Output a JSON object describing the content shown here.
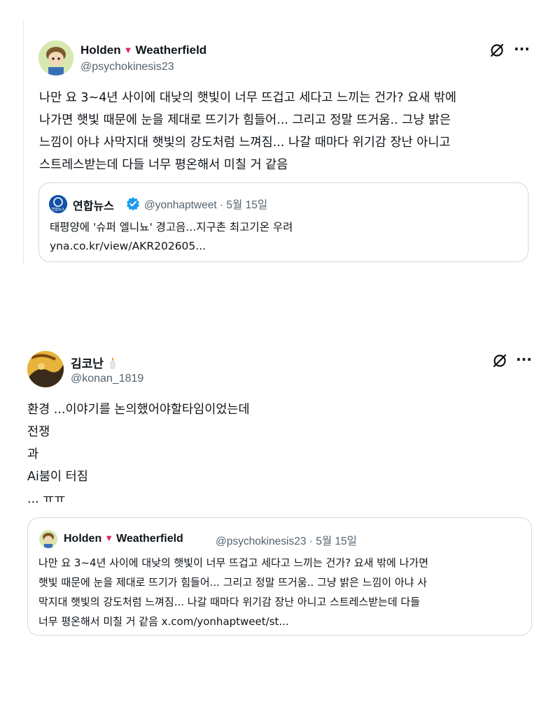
{
  "tweet1": {
    "author_name_first": "Holden",
    "author_name_last": "Weatherfield",
    "heart_glyph": "▼",
    "handle": "@psychokinesis23",
    "body_lines": [
      "나만 요 3~4년 사이에 대낮의 햇빛이 너무 뜨겁고 세다고 느끼는 건가? 요새 밖에",
      "나가면 햇빛 때문에 눈을 제대로 뜨기가 힘들어... 그리고 정말 뜨거움.. 그냥 밝은",
      "느낌이 아냐 사막지대 햇빛의 강도처럼 느껴짐... 나갈 때마다 위기감 장난 아니고",
      "스트레스받는데 다들 너무 평온해서 미칠 거 같음"
    ],
    "more_glyph": "···",
    "quote": {
      "logo_text": "연합뉴스",
      "name": "연합뉴스",
      "handle_date": "@yonhaptweet · 5월 15일",
      "headline": "태평양에 '슈퍼 엘니뇨' 경고음...지구촌 최고기온 우려",
      "link": "yna.co.kr/view/AKR202605..."
    }
  },
  "tweet2": {
    "author_name": "김코난",
    "handle": "@konan_1819",
    "body_lines": [
      "환경 ...이야기를 논의했어야할타임이었는데",
      "전쟁",
      "과",
      "Ai붐이 터짐",
      "... ㅠㅠ"
    ],
    "more_glyph": "···",
    "quote": {
      "name_first": "Holden",
      "name_last": "Weatherfield",
      "heart_glyph": "▼",
      "handle_date": "@psychokinesis23 · 5월 15일",
      "lines": [
        "나만 요 3~4년 사이에 대낮의 햇빛이 너무 뜨겁고 세다고 느끼는 건가? 요새 밖에 나가면",
        "햇빛 때문에 눈을 제대로 뜨기가 힘들어... 그리고 정말 뜨거움.. 그냥 밝은 느낌이 아냐 사",
        "막지대 햇빛의 강도처럼 느껴짐... 나갈 때마다 위기감 장난 아니고 스트레스받는데 다들",
        "너무 평온해서 미칠 거 같음 x.com/yonhaptweet/st..."
      ]
    }
  },
  "colors": {
    "text": "#0f1419",
    "secondary": "#536471",
    "border": "#cfd9de",
    "heart": "#e0245e",
    "verified": "#1d9bf0",
    "yonhap_blue": "#1351a5"
  },
  "icons": [
    "grok-icon",
    "more-icon",
    "verified-badge-icon",
    "candle-icon"
  ]
}
